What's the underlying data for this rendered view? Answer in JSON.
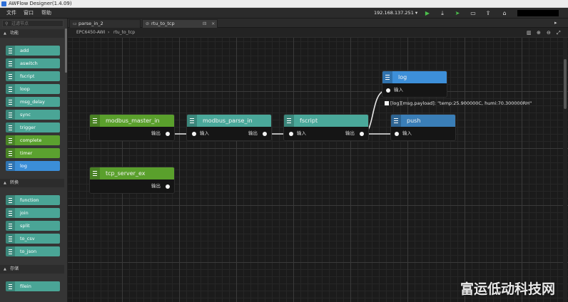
{
  "window": {
    "title": "AWFlow Designer(1.4.09)"
  },
  "menu": [
    "文件",
    "窗口",
    "帮助"
  ],
  "toolbar": {
    "ip": "192.168.137.251",
    "ip_caret": "▾",
    "icons": [
      "play-icon",
      "download-icon",
      "deploy-icon",
      "monitor-icon",
      "export-icon",
      "home-icon"
    ],
    "glyphs": [
      "▶",
      "⤓",
      "➤",
      "▭",
      "⇪",
      "⌂"
    ]
  },
  "sidebar": {
    "search_placeholder": "过滤节点",
    "search_glyph": "⚲",
    "sections": [
      {
        "label": "功能",
        "arrow": "▲",
        "items": [
          "add",
          "aswitch",
          "fscript",
          "loop",
          "msg_delay",
          "sync",
          "trigger",
          "complete",
          "timer",
          "log"
        ]
      },
      {
        "label": "转换",
        "arrow": "▲",
        "items": [
          "function",
          "join",
          "split",
          "to_csv",
          "to_json"
        ]
      },
      {
        "label": "存储",
        "arrow": "▲",
        "items": [
          "filein"
        ]
      }
    ]
  },
  "tabs": [
    {
      "label": "parse_in_2",
      "icon": "▭",
      "close": "×"
    },
    {
      "label": "rtu_to_tcp",
      "icon": "⊘",
      "close": "×",
      "extra": "⊟"
    }
  ],
  "tab_more": "▸",
  "breadcrumb": [
    "EPC6450-AWI",
    "rtu_to_tcp"
  ],
  "breadcrumb_sep": "›",
  "canvas_tools": [
    "▥",
    "⊕",
    "⊖",
    "⤢"
  ],
  "nodes": [
    {
      "id": "modbus_master_in",
      "label": "modbus_master_in",
      "output": "输出"
    },
    {
      "id": "modbus_parse_in",
      "label": "modbus_parse_in",
      "input": "输入",
      "output": "输出"
    },
    {
      "id": "fscript",
      "label": "fscript",
      "input": "输入",
      "output": "输出"
    },
    {
      "id": "log",
      "label": "log",
      "input": "输入"
    },
    {
      "id": "push",
      "label": "push",
      "input": "输入"
    },
    {
      "id": "tcp_server_ex",
      "label": "tcp_server_ex",
      "output": "输出"
    }
  ],
  "debug_output": "[log][msg.payload]: \"temp:25.900000C, humi:70.300000RH\"",
  "watermark": "富运低动科技网",
  "colors": {
    "function": "#5aa02c",
    "teal": "#4aa89a",
    "log": "#3d8fd9",
    "push": "#3a7eb7",
    "canvas": "#1b1b1b"
  }
}
